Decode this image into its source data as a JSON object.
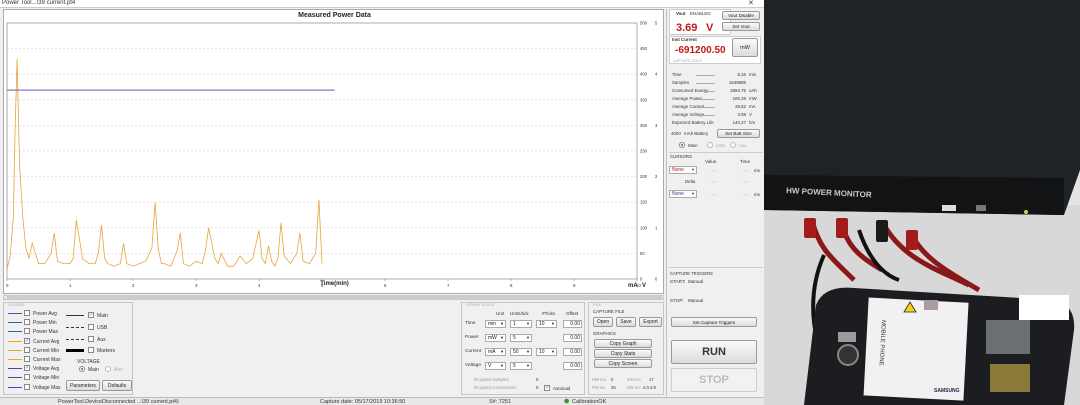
{
  "window": {
    "title": "Power Tool...\\39 current.pt4"
  },
  "plot": {
    "title": "Measured Power Data",
    "x_title": "Time(min)",
    "y_left_unit": "mA",
    "y_right_unit": "V",
    "x_ticks": [
      "0",
      "1",
      "2",
      "3",
      "4",
      "5",
      "6",
      "7",
      "8",
      "9",
      "10"
    ],
    "y_left_ticks": [
      "0",
      "50",
      "100",
      "150",
      "200",
      "250",
      "300",
      "350",
      "400",
      "450",
      "500"
    ],
    "y_right_ticks": [
      "0",
      "1",
      "2",
      "3",
      "4",
      "5"
    ]
  },
  "chart_data": {
    "type": "line",
    "title": "Measured Power Data",
    "xlabel": "Time(min)",
    "ylabel": "mA",
    "y2label": "V",
    "xlim": [
      0,
      10
    ],
    "ylim": [
      0,
      500
    ],
    "y2lim": [
      0,
      5
    ],
    "grid": true,
    "series": [
      {
        "name": "Current Avg",
        "axis": "left",
        "color": "#e8a33c",
        "x": [
          0,
          0.05,
          0.1,
          0.13,
          0.16,
          0.2,
          0.25,
          0.3,
          0.35,
          0.4,
          0.5,
          0.6,
          0.7,
          0.75,
          0.8,
          0.9,
          1.0,
          1.05,
          1.1,
          1.2,
          1.3,
          1.4,
          1.45,
          1.5,
          1.55,
          1.6,
          1.7,
          1.8,
          1.85,
          1.9,
          2.0,
          2.1,
          2.2,
          2.3,
          2.35,
          2.4,
          2.45,
          2.5,
          2.6,
          2.7,
          2.75,
          2.8,
          2.9,
          3.0,
          3.1,
          3.15,
          3.2,
          3.3,
          3.35,
          3.4,
          3.5,
          3.6,
          3.7,
          3.8,
          3.9,
          4.0,
          4.05,
          4.1,
          4.15,
          4.2,
          4.25,
          4.3,
          4.35,
          4.4,
          4.5,
          4.6,
          4.65,
          4.7,
          4.8,
          4.9,
          4.95,
          5.0
        ],
        "y": [
          20,
          45,
          120,
          300,
          430,
          220,
          120,
          60,
          40,
          70,
          30,
          30,
          50,
          90,
          35,
          30,
          30,
          40,
          115,
          40,
          30,
          30,
          50,
          105,
          40,
          30,
          25,
          30,
          70,
          30,
          25,
          30,
          35,
          60,
          150,
          60,
          30,
          30,
          25,
          55,
          90,
          30,
          25,
          35,
          30,
          55,
          100,
          40,
          30,
          50,
          25,
          25,
          45,
          30,
          40,
          95,
          40,
          30,
          65,
          35,
          25,
          40,
          110,
          45,
          30,
          50,
          90,
          35,
          30,
          50,
          155,
          30
        ]
      },
      {
        "name": "Voltage Avg",
        "axis": "right",
        "color": "#5a3fa8",
        "x": [
          0,
          5.2
        ],
        "y": [
          3.69,
          3.69
        ]
      }
    ]
  },
  "legend": {
    "items": [
      {
        "label": "Power Avg",
        "checked": false,
        "color": "#3d5fa8"
      },
      {
        "label": "Power Min",
        "checked": false,
        "color": "#3d5fa8"
      },
      {
        "label": "Power Max",
        "checked": false,
        "color": "#3d5fa8"
      },
      {
        "label": "Current Avg",
        "checked": true,
        "color": "#e8a33c"
      },
      {
        "label": "Current Min",
        "checked": false,
        "color": "#e8a33c"
      },
      {
        "label": "Current Max",
        "checked": false,
        "color": "#e8a33c"
      },
      {
        "label": "Voltage Avg",
        "checked": true,
        "color": "#5a3fa8"
      },
      {
        "label": "Voltage Min",
        "checked": false,
        "color": "#5a3fa8"
      },
      {
        "label": "Voltage Max",
        "checked": false,
        "color": "#5a3fa8"
      }
    ],
    "channels": [
      {
        "label": "Main",
        "checked": true
      },
      {
        "label": "USB",
        "checked": false
      },
      {
        "label": "Aux",
        "checked": false
      }
    ],
    "markers_label": "Markers",
    "voltage_label": "VOLTAGE",
    "voltage_main": "Main",
    "voltage_aux": "Aux",
    "parameters_label": "Parameters",
    "defaults_label": "Defaults"
  },
  "scale": {
    "group_title": "GRAPH SCALE",
    "headers": [
      "Unit",
      "Units/tick",
      "#Ticks",
      "Offset"
    ],
    "rows": [
      {
        "label": "Time",
        "unit": "min",
        "units_per_tick": "1",
        "ticks": "10",
        "offset": "0.00"
      },
      {
        "label": "Power",
        "unit": "mW",
        "units_per_tick": "5",
        "ticks": "",
        "offset": "0.00"
      },
      {
        "label": "Current",
        "unit": "mA",
        "units_per_tick": "50",
        "ticks": "10",
        "offset": "0.00"
      },
      {
        "label": "Voltage",
        "unit": "V",
        "units_per_tick": "5",
        "ticks": "",
        "offset": "0.00"
      }
    ],
    "dropped_samples_label": "Dropped samples:",
    "dropped_samples_value": "0",
    "dropped_connections_label": "Dropped connections:",
    "dropped_connections_value": "0",
    "autoload_label": "Autoload"
  },
  "capture": {
    "group_title": "FILE",
    "capture_file_label": "CAPTURE FILE",
    "open_label": "Open",
    "save_label": "Save",
    "export_label": "Export",
    "graphics_label": "GRAPHICS",
    "copy_graph_label": "Copy Graph",
    "copy_stats_label": "Copy Stats",
    "copy_screen_label": "Copy Screen",
    "hw_rev_label": "HW rev",
    "hw_rev_value": "0",
    "inst_rev_label": "Inst rev",
    "inst_rev_value": "17",
    "fw_rev_label": "FW rev",
    "fw_rev_value": "26",
    "sw_rev_label": "SW rev",
    "sw_rev_value": "4.0.4.9"
  },
  "status": {
    "connection": "PowerTool.DeviceDisconnected ...\\39 current.pt4)",
    "capture_date": "Capture date: 05/17/2019 10:36:50",
    "serial": "S#: 7251",
    "calibration": "CalibrationOK"
  },
  "vout": {
    "label": "Vout",
    "state": "ENABLED",
    "value": "3.69",
    "unit": "V",
    "disable_label": "Vout Disable",
    "set_label": "Set Vout"
  },
  "inst": {
    "label": "Inst Current",
    "value": "-691200.50",
    "unit_button": "mW",
    "sub": "CAPTURE STATS"
  },
  "stats": [
    {
      "label": "Time",
      "value": "5.16",
      "unit": "min"
    },
    {
      "label": "Samples",
      "value": "1549898",
      "unit": ""
    },
    {
      "label": "Consumed Energy",
      "value": "2694.75",
      "unit": "uAh"
    },
    {
      "label": "Average Power",
      "value": "105.28",
      "unit": "mW"
    },
    {
      "label": "Average Current",
      "value": "28.52",
      "unit": "mA"
    },
    {
      "label": "Average Voltage",
      "value": "3.69",
      "unit": "V"
    },
    {
      "label": "Expected Battery Life",
      "value": "140.27",
      "unit": "hrs"
    }
  ],
  "battery": {
    "capacity": "4000",
    "unit_label": "mAh Battery",
    "set_label": "Set Batt Size"
  },
  "channel": {
    "main": "Main",
    "usb": "USB",
    "aux": "Aux"
  },
  "cursors": {
    "title": "CURSORS",
    "value_header": "Value",
    "time_header": "Time",
    "none1": "None",
    "none2": "None",
    "delta_label": "Delta",
    "dash": "-.---",
    "ms": "ms"
  },
  "triggers": {
    "title": "CAPTURE TRIGGERS",
    "start_label": "START:",
    "start_value": "Manual",
    "stop_label": "STOP:",
    "stop_value": "Manual",
    "set_label": "Set Capture Triggers"
  },
  "run": {
    "run_label": "RUN",
    "stop_label": "STOP"
  },
  "photo": {
    "monitor_label": "HW POWER MONITOR",
    "phone_label": "MOBILE PHONE",
    "brand_label": "SAMSUNG"
  }
}
